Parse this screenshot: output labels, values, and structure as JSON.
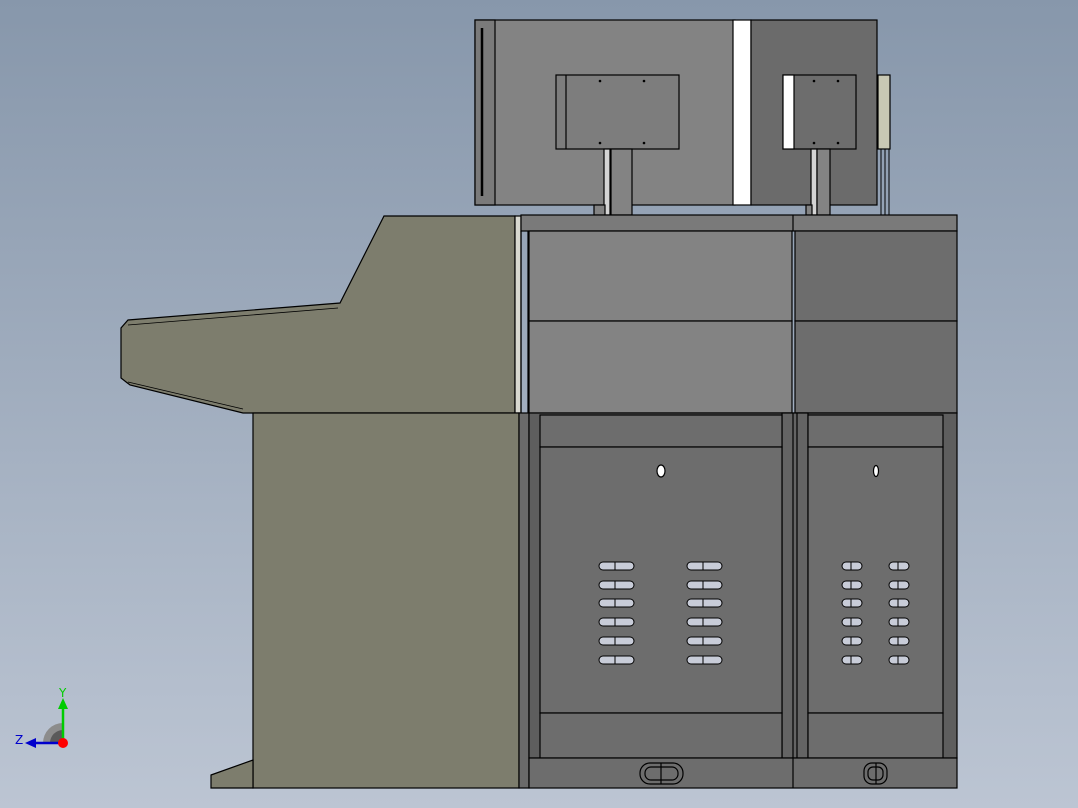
{
  "viewport": {
    "background_top": "#8797ab",
    "background_bottom": "#bcc5d3"
  },
  "model": {
    "colors": {
      "cabinet_side": "#7d7d6d",
      "panel_gray": "#838383",
      "panel_dark": "#6d6d6d",
      "frame_dark": "#5d5d5d",
      "monitor_light": "#838383",
      "monitor_dark": "#6b6b6b",
      "highlight": "#ffffff",
      "edge": "#000000",
      "slot_fill": "#c8ccd8",
      "connector": "#c8c8b4"
    }
  },
  "triad": {
    "y_label": "Y",
    "z_label": "Z",
    "y_color": "#00cc00",
    "z_color": "#0000cc",
    "x_color": "#ff0000"
  }
}
